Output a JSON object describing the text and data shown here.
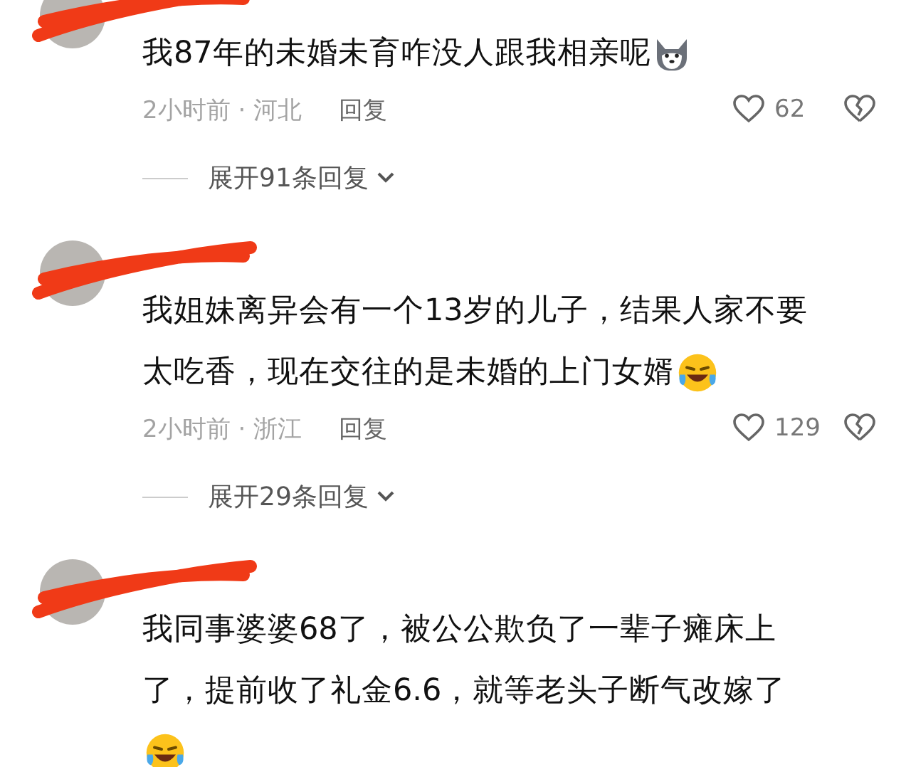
{
  "comments": [
    {
      "lines": [
        "我87年的未婚未育咋没人跟我相亲呢"
      ],
      "emoji": {
        "kind": "dog",
        "own_line": false
      },
      "time": "2小时前 · 河北",
      "reply": "回复",
      "likes": "62",
      "expand": "展开91条回复"
    },
    {
      "lines": [
        "我姐妹离异会有一个13岁的儿子，结果人家不要",
        "太吃香，现在交往的是未婚的上门女婿"
      ],
      "emoji": {
        "kind": "laugh",
        "own_line": false
      },
      "time": "2小时前 · 浙江",
      "reply": "回复",
      "likes": "129",
      "expand": "展开29条回复"
    },
    {
      "lines": [
        "我同事婆婆68了，被公公欺负了一辈子瘫床上",
        "了，提前收了礼金6.6，就等老头子断气改嫁了"
      ],
      "emoji": {
        "kind": "laugh",
        "own_line": true
      }
    }
  ]
}
